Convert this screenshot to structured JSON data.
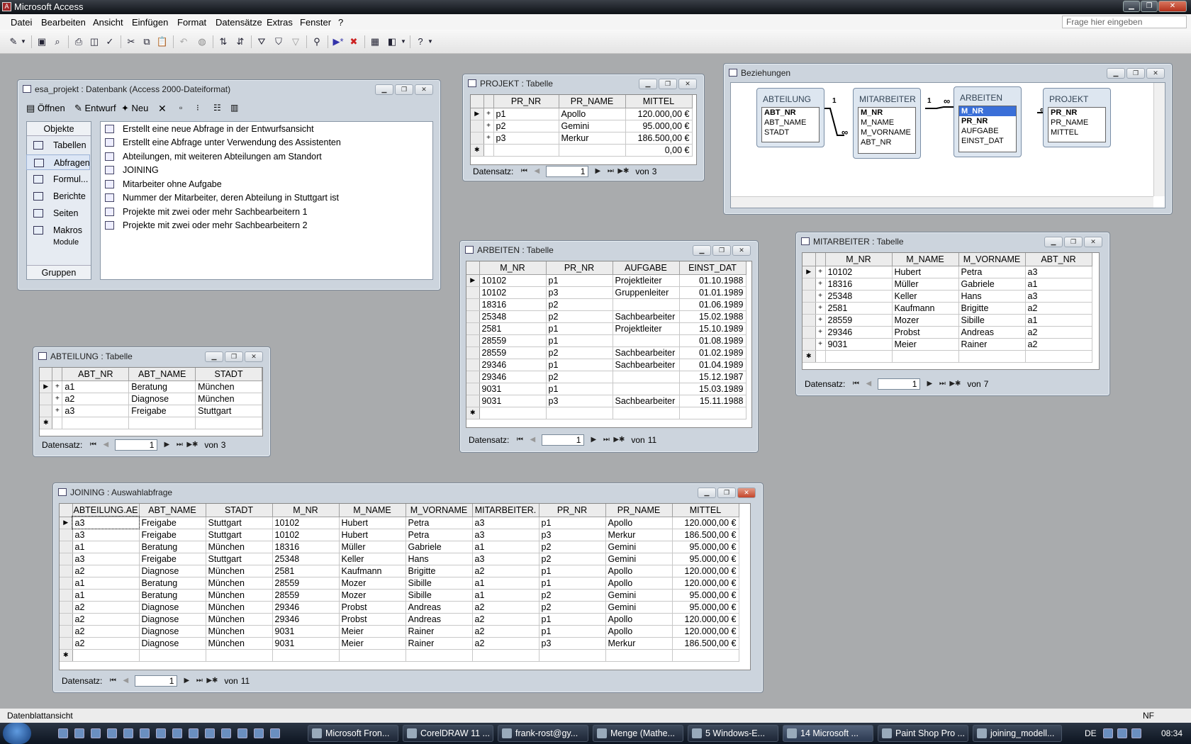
{
  "app": {
    "title": "Microsoft Access"
  },
  "menu": [
    "Datei",
    "Bearbeiten",
    "Ansicht",
    "Einfügen",
    "Format",
    "Datensätze",
    "Extras",
    "Fenster",
    "?"
  ],
  "help_placeholder": "Frage hier eingeben",
  "db_window": {
    "title": "esa_projekt : Datenbank (Access 2000-Dateiformat)",
    "toolbar": {
      "open": "Öffnen",
      "design": "Entwurf",
      "new": "Neu"
    },
    "objects_header": "Objekte",
    "objects": [
      "Tabellen",
      "Abfragen",
      "Formul...",
      "Berichte",
      "Seiten",
      "Makros",
      "Module"
    ],
    "groups": "Gruppen",
    "queries": [
      "Erstellt eine neue Abfrage in der Entwurfsansicht",
      "Erstellt eine Abfrage unter Verwendung des Assistenten",
      "Abteilungen, mit weiteren Abteilungen am Standort",
      "JOINING",
      "Mitarbeiter ohne Aufgabe",
      "Nummer der Mitarbeiter, deren Abteilung in Stuttgart ist",
      "Projekte mit zwei oder mehr Sachbearbeitern 1",
      "Projekte mit zwei oder mehr Sachbearbeitern 2"
    ]
  },
  "nav": {
    "label": "Datensatz:",
    "of": "von",
    "current": "1"
  },
  "projekt": {
    "title": "PROJEKT : Tabelle",
    "columns": [
      "PR_NR",
      "PR_NAME",
      "MITTEL"
    ],
    "rows": [
      [
        "p1",
        "Apollo",
        "120.000,00 €"
      ],
      [
        "p2",
        "Gemini",
        "95.000,00 €"
      ],
      [
        "p3",
        "Merkur",
        "186.500,00 €"
      ]
    ],
    "new_row": "0,00 €",
    "count": "3"
  },
  "beziehungen": {
    "title": "Beziehungen",
    "one": "1",
    "many": "∞",
    "abteilung": {
      "name": "ABTEILUNG",
      "fields": [
        "ABT_NR",
        "ABT_NAME",
        "STADT"
      ]
    },
    "mitarbeiter": {
      "name": "MITARBEITER",
      "fields": [
        "M_NR",
        "M_NAME",
        "M_VORNAME",
        "ABT_NR"
      ]
    },
    "arbeiten": {
      "name": "ARBEITEN",
      "fields": [
        "M_NR",
        "PR_NR",
        "AUFGABE",
        "EINST_DAT"
      ]
    },
    "projekt": {
      "name": "PROJEKT",
      "fields": [
        "PR_NR",
        "PR_NAME",
        "MITTEL"
      ]
    }
  },
  "arbeiten": {
    "title": "ARBEITEN : Tabelle",
    "columns": [
      "M_NR",
      "PR_NR",
      "AUFGABE",
      "EINST_DAT"
    ],
    "rows": [
      [
        "10102",
        "p1",
        "Projektleiter",
        "01.10.1988"
      ],
      [
        "10102",
        "p3",
        "Gruppenleiter",
        "01.01.1989"
      ],
      [
        "18316",
        "p2",
        "",
        "01.06.1989"
      ],
      [
        "25348",
        "p2",
        "Sachbearbeiter",
        "15.02.1988"
      ],
      [
        "2581",
        "p1",
        "Projektleiter",
        "15.10.1989"
      ],
      [
        "28559",
        "p1",
        "",
        "01.08.1989"
      ],
      [
        "28559",
        "p2",
        "Sachbearbeiter",
        "01.02.1989"
      ],
      [
        "29346",
        "p1",
        "Sachbearbeiter",
        "01.04.1989"
      ],
      [
        "29346",
        "p2",
        "",
        "15.12.1987"
      ],
      [
        "9031",
        "p1",
        "",
        "15.03.1989"
      ],
      [
        "9031",
        "p3",
        "Sachbearbeiter",
        "15.11.1988"
      ]
    ],
    "count": "11"
  },
  "mitarbeiter": {
    "title": "MITARBEITER : Tabelle",
    "columns": [
      "M_NR",
      "M_NAME",
      "M_VORNAME",
      "ABT_NR"
    ],
    "rows": [
      [
        "10102",
        "Hubert",
        "Petra",
        "a3"
      ],
      [
        "18316",
        "Müller",
        "Gabriele",
        "a1"
      ],
      [
        "25348",
        "Keller",
        "Hans",
        "a3"
      ],
      [
        "2581",
        "Kaufmann",
        "Brigitte",
        "a2"
      ],
      [
        "28559",
        "Mozer",
        "Sibille",
        "a1"
      ],
      [
        "29346",
        "Probst",
        "Andreas",
        "a2"
      ],
      [
        "9031",
        "Meier",
        "Rainer",
        "a2"
      ]
    ],
    "count": "7"
  },
  "abteilung": {
    "title": "ABTEILUNG : Tabelle",
    "columns": [
      "ABT_NR",
      "ABT_NAME",
      "STADT"
    ],
    "rows": [
      [
        "a1",
        "Beratung",
        "München"
      ],
      [
        "a2",
        "Diagnose",
        "München"
      ],
      [
        "a3",
        "Freigabe",
        "Stuttgart"
      ]
    ],
    "count": "3"
  },
  "joining": {
    "title": "JOINING : Auswahlabfrage",
    "columns": [
      "ABTEILUNG.AE",
      "ABT_NAME",
      "STADT",
      "M_NR",
      "M_NAME",
      "M_VORNAME",
      "MITARBEITER.",
      "PR_NR",
      "PR_NAME",
      "MITTEL"
    ],
    "rows": [
      [
        "a3",
        "Freigabe",
        "Stuttgart",
        "10102",
        "Hubert",
        "Petra",
        "a3",
        "p1",
        "Apollo",
        "120.000,00 €"
      ],
      [
        "a3",
        "Freigabe",
        "Stuttgart",
        "10102",
        "Hubert",
        "Petra",
        "a3",
        "p3",
        "Merkur",
        "186.500,00 €"
      ],
      [
        "a1",
        "Beratung",
        "München",
        "18316",
        "Müller",
        "Gabriele",
        "a1",
        "p2",
        "Gemini",
        "95.000,00 €"
      ],
      [
        "a3",
        "Freigabe",
        "Stuttgart",
        "25348",
        "Keller",
        "Hans",
        "a3",
        "p2",
        "Gemini",
        "95.000,00 €"
      ],
      [
        "a2",
        "Diagnose",
        "München",
        "2581",
        "Kaufmann",
        "Brigitte",
        "a2",
        "p1",
        "Apollo",
        "120.000,00 €"
      ],
      [
        "a1",
        "Beratung",
        "München",
        "28559",
        "Mozer",
        "Sibille",
        "a1",
        "p1",
        "Apollo",
        "120.000,00 €"
      ],
      [
        "a1",
        "Beratung",
        "München",
        "28559",
        "Mozer",
        "Sibille",
        "a1",
        "p2",
        "Gemini",
        "95.000,00 €"
      ],
      [
        "a2",
        "Diagnose",
        "München",
        "29346",
        "Probst",
        "Andreas",
        "a2",
        "p2",
        "Gemini",
        "95.000,00 €"
      ],
      [
        "a2",
        "Diagnose",
        "München",
        "29346",
        "Probst",
        "Andreas",
        "a2",
        "p1",
        "Apollo",
        "120.000,00 €"
      ],
      [
        "a2",
        "Diagnose",
        "München",
        "9031",
        "Meier",
        "Rainer",
        "a2",
        "p1",
        "Apollo",
        "120.000,00 €"
      ],
      [
        "a2",
        "Diagnose",
        "München",
        "9031",
        "Meier",
        "Rainer",
        "a2",
        "p3",
        "Merkur",
        "186.500,00 €"
      ]
    ],
    "count": "11"
  },
  "status": {
    "left": "Datenblattansicht",
    "right": "NF"
  },
  "taskbar": {
    "tasks": [
      "Microsoft Fron...",
      "CorelDRAW 11 ...",
      "frank-rost@gy...",
      "Menge (Mathe...",
      "5 Windows-E...",
      "14 Microsoft ...",
      "Paint Shop Pro ...",
      "joining_modell..."
    ],
    "lang": "DE",
    "clock": "08:34"
  }
}
